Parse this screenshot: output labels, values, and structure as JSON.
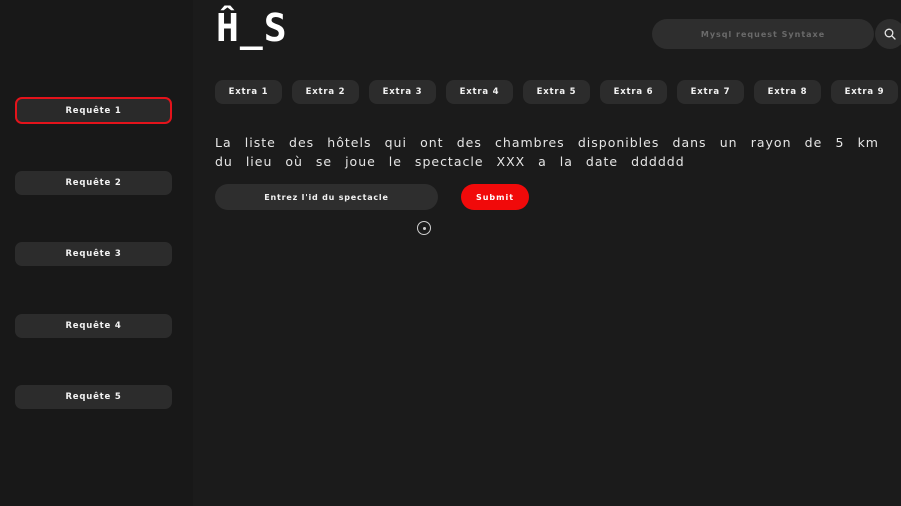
{
  "header": {
    "logo": "Ĥ_S",
    "search": {
      "placeholder": "Mysql request Syntaxe",
      "icon": "search-icon"
    }
  },
  "sidebar": {
    "items": [
      {
        "label": "Requête 1",
        "active": true
      },
      {
        "label": "Requête 2",
        "active": false
      },
      {
        "label": "Requête 3",
        "active": false
      },
      {
        "label": "Requête 4",
        "active": false
      },
      {
        "label": "Requête 5",
        "active": false
      }
    ]
  },
  "extras": [
    {
      "label": "Extra 1"
    },
    {
      "label": "Extra 2"
    },
    {
      "label": "Extra 3"
    },
    {
      "label": "Extra 4"
    },
    {
      "label": "Extra 5"
    },
    {
      "label": "Extra 6"
    },
    {
      "label": "Extra 7"
    },
    {
      "label": "Extra 8"
    },
    {
      "label": "Extra 9"
    }
  ],
  "main": {
    "description": "La liste des hôtels qui ont des chambres disponibles dans un rayon de 5 km du lieu où se joue le spectacle XXX a la date dddddd",
    "id_input": {
      "placeholder": "Entrez l'id du spectacle",
      "value": ""
    },
    "submit_label": "Submit",
    "loader_icon": "loading-spinner-icon"
  },
  "colors": {
    "background": "#1a1a1a",
    "accent_red": "#f10a0a",
    "active_border": "#e3131b",
    "button_bg": "#2c2c2c"
  }
}
